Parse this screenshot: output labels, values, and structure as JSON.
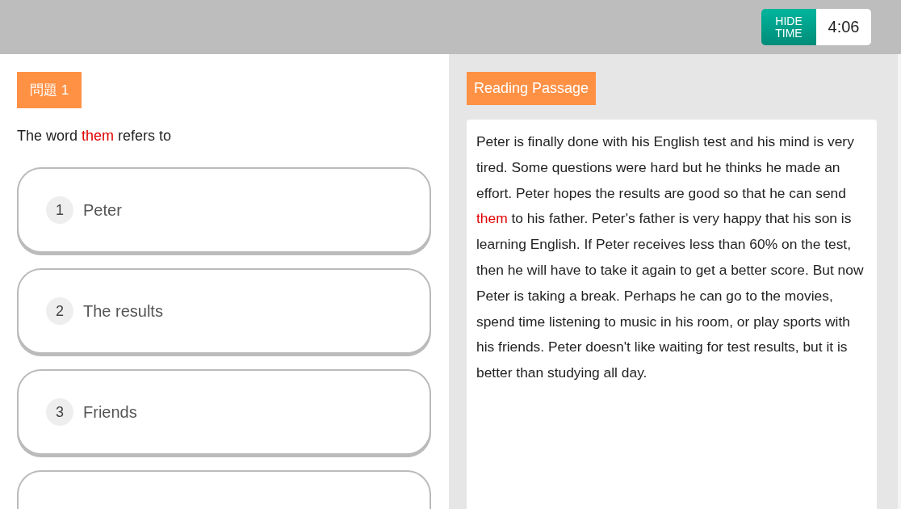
{
  "header": {
    "hide_time_button": "HIDE\nTIME",
    "timer": "4:06"
  },
  "question": {
    "badge": "問題 1",
    "prompt": [
      {
        "text": "The word ",
        "highlighted": false
      },
      {
        "text": "them",
        "highlighted": true
      },
      {
        "text": " refers to",
        "highlighted": false
      }
    ],
    "options": [
      {
        "kind": "choice",
        "number": "1",
        "label": "Peter"
      },
      {
        "kind": "choice",
        "number": "2",
        "label": "The results"
      },
      {
        "kind": "choice",
        "number": "3",
        "label": "Friends"
      },
      {
        "kind": "partial"
      }
    ]
  },
  "passage": {
    "badge": "Reading Passage",
    "text": [
      {
        "text": "Peter is finally done with his English test and his mind is very tired. Some questions were hard but he thinks he made an effort. Peter hopes the results are good so that he can send ",
        "highlighted": false
      },
      {
        "text": "them",
        "highlighted": true
      },
      {
        "text": " to his father. Peter's father is very happy that his son is learning English. If Peter receives less than 60% on the test, then he will have to take it again to get a better score. But now Peter is taking a break. Perhaps he can go to the movies, spend time listening to music in his room, or play sports with his friends. Peter doesn't like waiting for test results, but it is better than studying all day.",
        "highlighted": false
      }
    ]
  }
}
